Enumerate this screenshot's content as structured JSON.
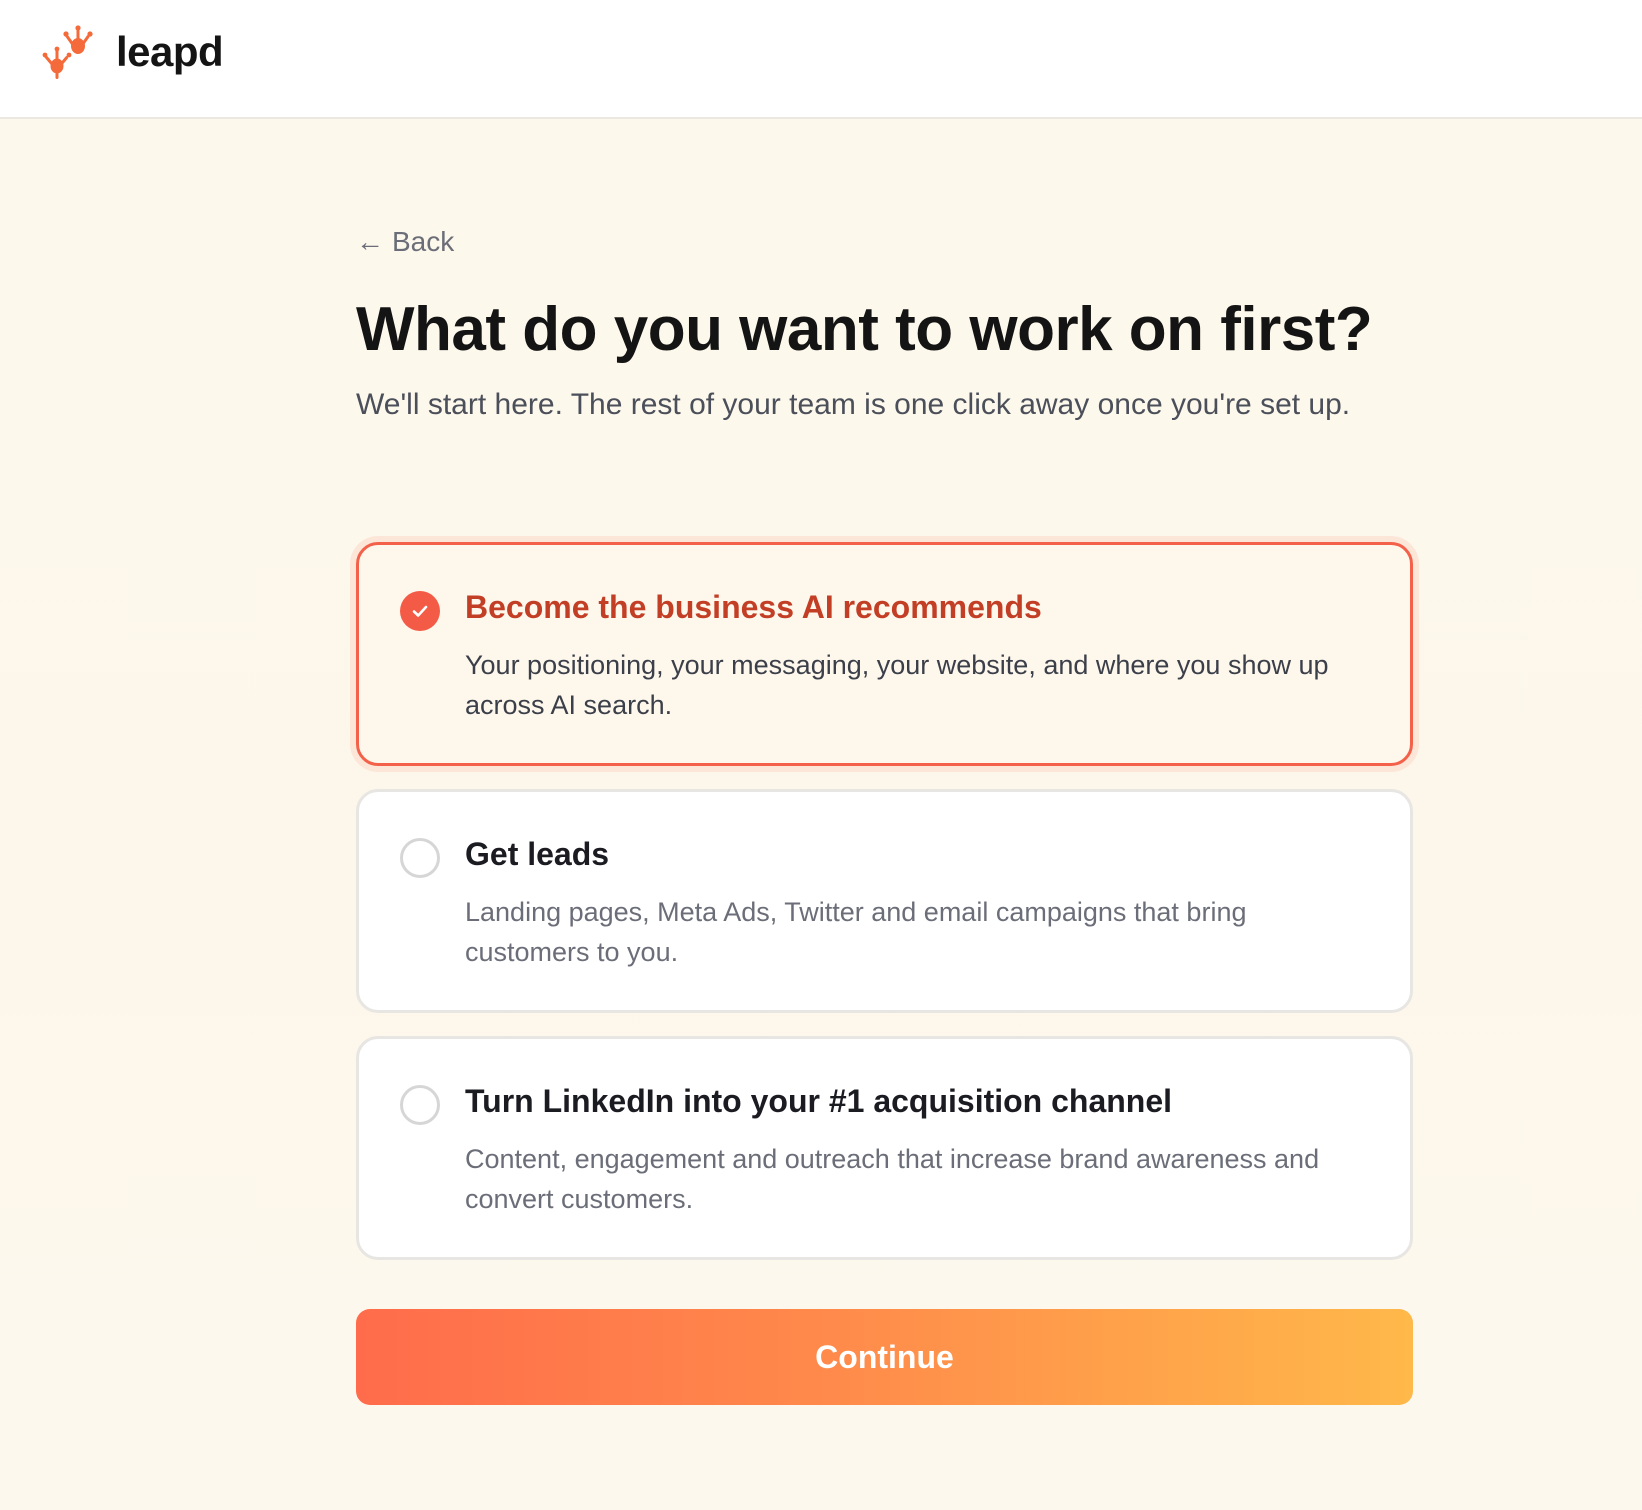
{
  "brand": {
    "name": "leapd",
    "logo_icon": "frog-footprints-icon",
    "accent_color": "#f45b46"
  },
  "back": {
    "arrow": "←",
    "label": "Back"
  },
  "page": {
    "title": "What do you want to work on first?",
    "subtitle": "We'll start here. The rest of your team is one click away once you're set up."
  },
  "options": [
    {
      "title": "Become the business AI recommends",
      "description": "Your positioning, your messaging, your website, and where you show up across AI search.",
      "selected": true
    },
    {
      "title": "Get leads",
      "description": "Landing pages, Meta Ads, Twitter and email campaigns that bring customers to you.",
      "selected": false
    },
    {
      "title": "Turn LinkedIn into your #1 acquisition channel",
      "description": "Content, engagement and outreach that increase brand awareness and convert customers.",
      "selected": false
    }
  ],
  "continue_button": {
    "label": "Continue"
  }
}
